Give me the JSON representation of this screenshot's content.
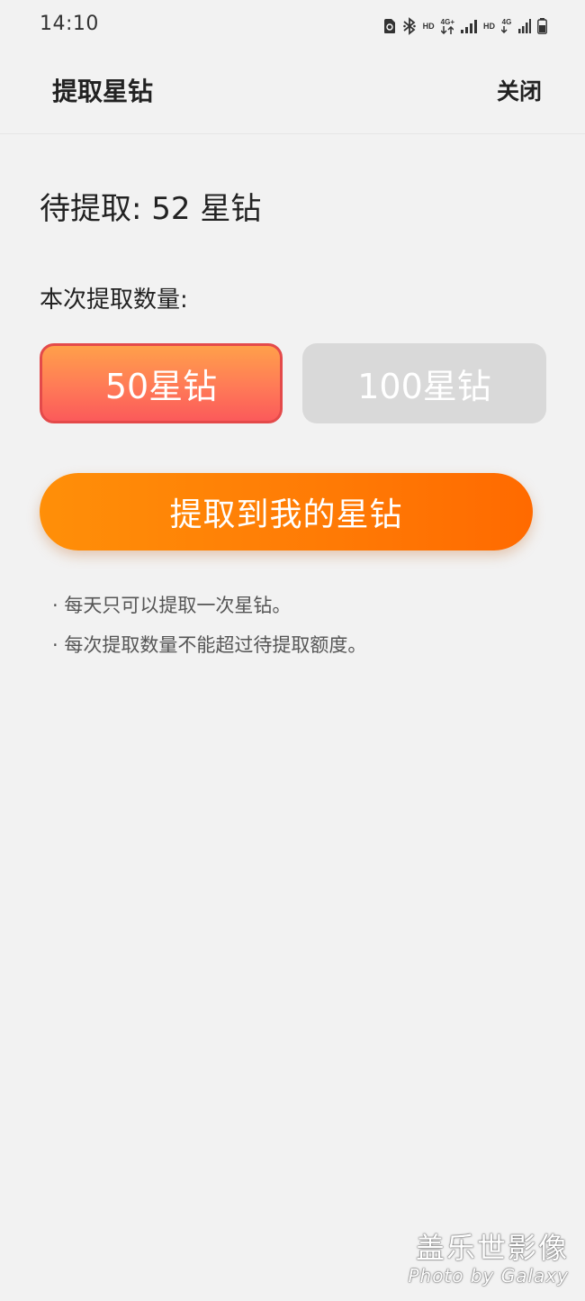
{
  "status_bar": {
    "time": "14:10",
    "icons": [
      "sim-alert-icon",
      "bluetooth-icon",
      "hd-icon",
      "4g-data-icon",
      "signal-icon",
      "hd-icon",
      "4g-icon",
      "signal-icon",
      "battery-icon"
    ],
    "hd_label": "HD",
    "net_label_1": "4G+",
    "net_label_2": "4G"
  },
  "header": {
    "title": "提取星钻",
    "close_label": "关闭"
  },
  "main": {
    "pending_text": "待提取: 52 星钻",
    "quantity_label": "本次提取数量:",
    "options": [
      {
        "label": "50星钻",
        "selected": true
      },
      {
        "label": "100星钻",
        "selected": false
      }
    ],
    "extract_button": "提取到我的星钻",
    "notes": [
      "· 每天只可以提取一次星钻。",
      "· 每次提取数量不能超过待提取额度。"
    ]
  },
  "watermark": {
    "title": "盖乐世影像",
    "subtitle": "Photo by Galaxy"
  },
  "colors": {
    "background": "#f2f2f2",
    "accent_orange": "#ff7a05",
    "selected_border": "#e44a4a",
    "unselected_option": "#d9d9d9"
  }
}
